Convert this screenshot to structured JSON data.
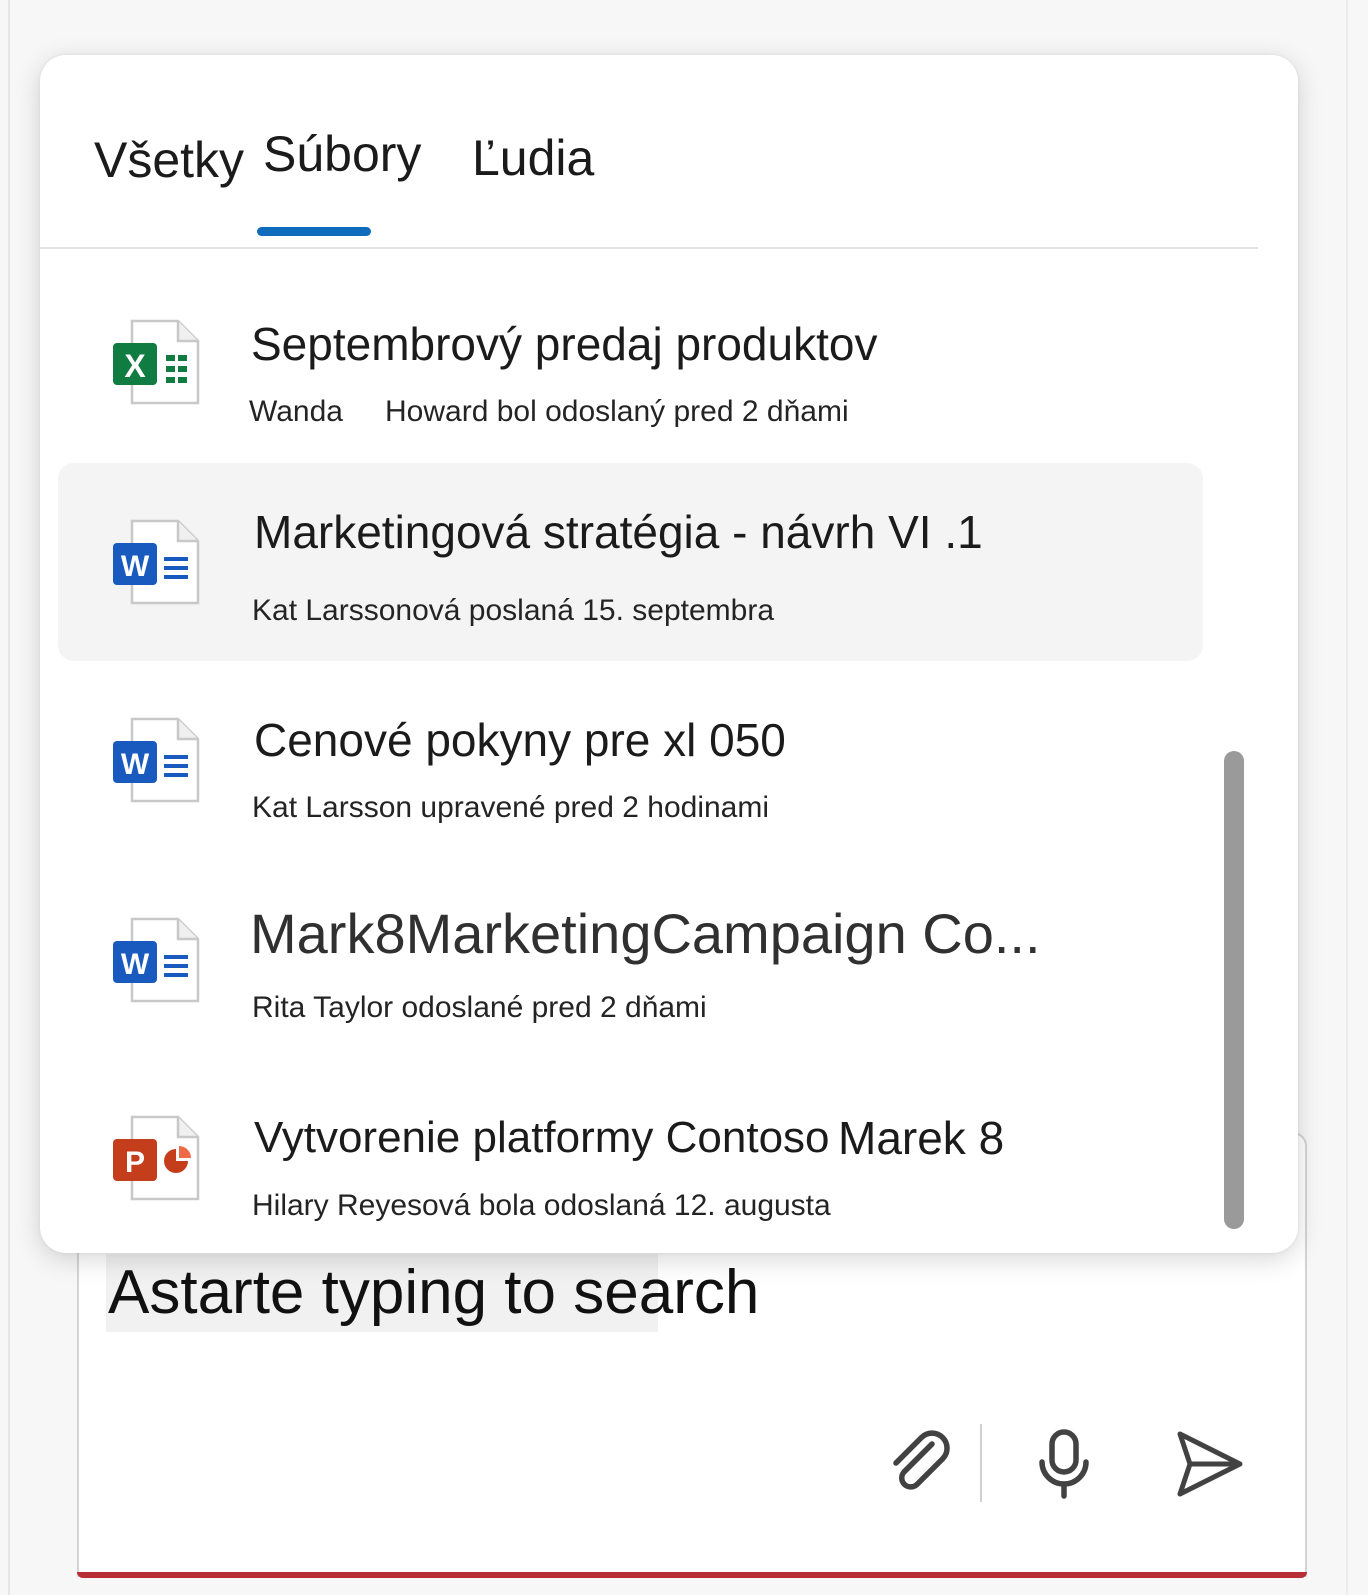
{
  "tabs": [
    {
      "label": "Všetky"
    },
    {
      "label": "Súbory"
    },
    {
      "label": "Ľudia"
    }
  ],
  "active_tab": "Súbory",
  "files": [
    {
      "app": "excel",
      "icon_letter": "X",
      "title": "Septembrový predaj produktov",
      "sender": "Wanda",
      "meta": "Howard bol odoslaný pred 2 dňami"
    },
    {
      "app": "word",
      "icon_letter": "W",
      "title": "Marketingová stratégia - návrh VI .1",
      "meta": "Kat Larssonová poslaná 15. septembra"
    },
    {
      "app": "word",
      "icon_letter": "W",
      "title": "Cenové pokyny pre xl 050",
      "meta": "Kat Larsson upravené pred 2 hodinami"
    },
    {
      "app": "word",
      "icon_letter": "W",
      "title": "Mark8MarketingCampaign Co...",
      "meta": "Rita Taylor odoslané pred 2 dňami"
    },
    {
      "app": "powerpoint",
      "icon_letter": "P",
      "title": "Vytvorenie platformy Contoso",
      "title_suffix": "Marek 8",
      "meta": "Hilary Reyesová bola odoslaná 12. augusta"
    }
  ],
  "compose": {
    "placeholder": "Astarte typing to search"
  },
  "toolbar": {
    "attach_icon": "paperclip-icon",
    "mic_icon": "microphone-icon",
    "send_icon": "send-icon"
  },
  "colors": {
    "accent": "#0f6cbd",
    "excel": "#107c41",
    "word": "#185abd",
    "powerpoint": "#c43e1c",
    "compose_underline": "#b72e34"
  }
}
